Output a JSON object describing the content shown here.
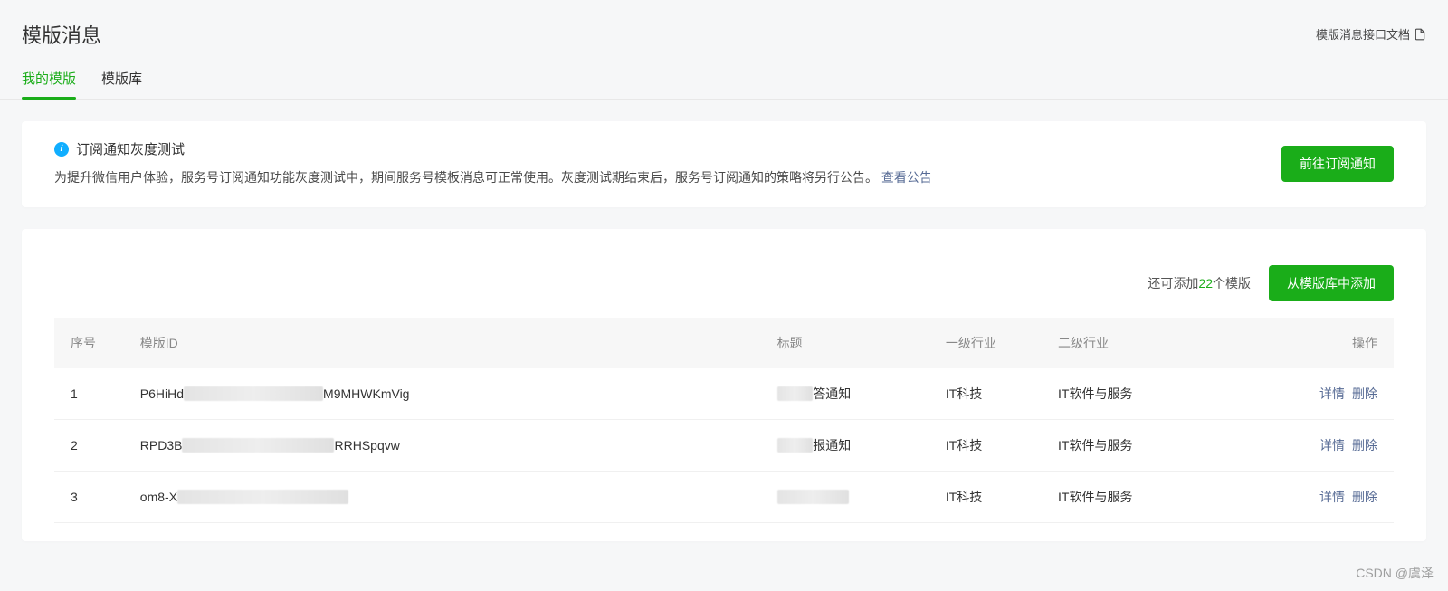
{
  "header": {
    "title": "模版消息",
    "doc_link_label": "模版消息接口文档"
  },
  "tabs": [
    {
      "label": "我的模版",
      "active": true
    },
    {
      "label": "模版库",
      "active": false
    }
  ],
  "notice": {
    "title": "订阅通知灰度测试",
    "desc": "为提升微信用户体验，服务号订阅通知功能灰度测试中，期间服务号模板消息可正常使用。灰度测试期结束后，服务号订阅通知的策略将另行公告。",
    "link_label": "查看公告",
    "button_label": "前往订阅通知"
  },
  "quota": {
    "prefix": "还可添加",
    "count": "22",
    "suffix": "个模版"
  },
  "toolbar": {
    "add_button_label": "从模版库中添加"
  },
  "table": {
    "headers": {
      "seq": "序号",
      "id": "模版ID",
      "title": "标题",
      "cat1": "一级行业",
      "cat2": "二级行业",
      "ops": "操作"
    },
    "rows": [
      {
        "seq": "1",
        "id_prefix": "P6HiHd",
        "id_blur": "xxxxxxxxxxxxxxxxxxxxxx",
        "id_suffix": "M9MHWKmVig",
        "title_blur": "████",
        "title_suffix": "答通知",
        "cat1": "IT科技",
        "cat2": "IT软件与服务"
      },
      {
        "seq": "2",
        "id_prefix": "RPD3B",
        "id_blur": "xxxxxxxxxxxxxxxxxxxxxxxx",
        "id_suffix": "RRHSpqvw",
        "title_blur": "████",
        "title_suffix": "报通知",
        "cat1": "IT科技",
        "cat2": "IT软件与服务"
      },
      {
        "seq": "3",
        "id_prefix": "om8-X",
        "id_blur": "xxxxxxxxxxxxxxxxxxxxxxxxxxx",
        "id_suffix": "",
        "title_blur": "████████",
        "title_suffix": "",
        "cat1": "IT科技",
        "cat2": "IT软件与服务"
      }
    ],
    "ops": {
      "detail": "详情",
      "delete": "删除"
    }
  },
  "watermark": "CSDN @虞泽"
}
